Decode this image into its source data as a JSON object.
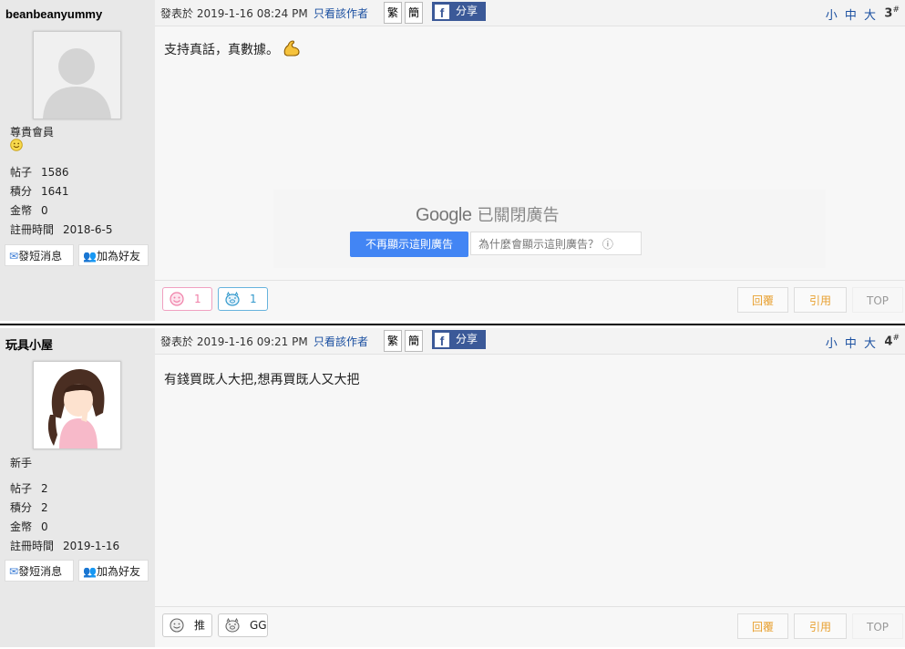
{
  "posts": [
    {
      "username": "beanbeanyummy",
      "rank": "尊貴會員",
      "stats": [
        {
          "label": "帖子",
          "value": "1586"
        },
        {
          "label": "積分",
          "value": "1641"
        },
        {
          "label": "金幣",
          "value": "0"
        },
        {
          "label": "註冊時間",
          "value": "2018-6-5"
        }
      ],
      "send_msg": "發短消息",
      "add_friend": "加為好友",
      "posted": "發表於 2019-1-16 08:24 PM",
      "only_author": "只看該作者",
      "trad": "繁",
      "simp": "簡",
      "share": "分享",
      "font_sizes": "小 中 大",
      "floor": "3",
      "floor_mark": "#",
      "message": "支持真話，真數據。",
      "emoji": "flexed-biceps",
      "reactions": [
        {
          "label": "1",
          "color": "#f080a8"
        },
        {
          "label": "1",
          "color": "#3399cc"
        }
      ],
      "reply": "回覆",
      "quote": "引用",
      "top": "TOP"
    },
    {
      "username": "玩具小屋",
      "rank": "新手",
      "stats": [
        {
          "label": "帖子",
          "value": "2"
        },
        {
          "label": "積分",
          "value": "2"
        },
        {
          "label": "金幣",
          "value": "0"
        },
        {
          "label": "註冊時間",
          "value": "2019-1-16"
        }
      ],
      "send_msg": "發短消息",
      "add_friend": "加為好友",
      "posted": "發表於 2019-1-16 09:21 PM",
      "only_author": "只看該作者",
      "trad": "繁",
      "simp": "簡",
      "share": "分享",
      "font_sizes": "小 中 大",
      "floor": "4",
      "floor_mark": "#",
      "message": "有錢買既人大把,想再買既人又大把",
      "reactions": [
        {
          "label": "推",
          "color": "#222"
        },
        {
          "label": "GG",
          "color": "#222"
        }
      ],
      "reply": "回覆",
      "quote": "引用",
      "top": "TOP"
    }
  ],
  "ad": {
    "brand": "Google",
    "closed": "已關閉廣告",
    "stop": "不再顯示這則廣告",
    "why": "為什麼會顯示這則廣告？ ⓘ"
  },
  "colors": {
    "reply": "#e8a030",
    "link": "#1a4fa0",
    "facebook": "#3b5998",
    "ad_button": "#4285f4"
  }
}
